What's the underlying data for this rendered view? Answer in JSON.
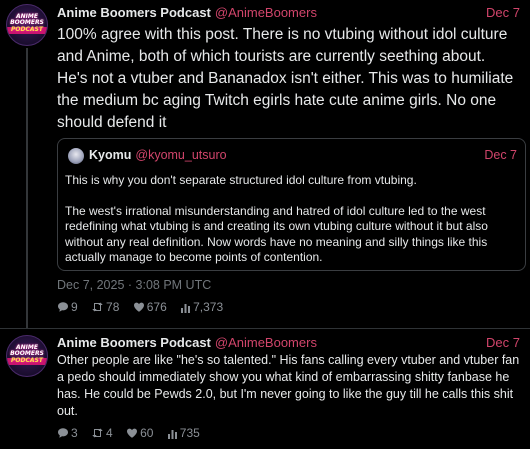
{
  "posts": [
    {
      "author": "Anime Boomers Podcast",
      "handle": "@AnimeBoomers",
      "date": "Dec 7",
      "avatar_text": [
        "ANIME",
        "BOOMERS",
        "PODCAST"
      ],
      "text": "100% agree with this post. There is no vtubing without idol culture and Anime, both of which tourists are currently seething about. He's not a vtuber and Bananadox isn't either. This was to humiliate the medium bc aging Twitch egirls hate cute anime girls. No one should defend it",
      "quote": {
        "author": "Kyomu",
        "handle": "@kyomu_utsuro",
        "date": "Dec 7",
        "paragraph1": "This is why you don't separate structured idol culture from vtubing.",
        "paragraph2": "The west's irrational misunderstanding and hatred of idol culture led to the west redefining what vtubing is and creating its own vtubing culture without it but also without any real definition. Now words have no meaning and silly things like this actually manage to become points of contention."
      },
      "timestamp": "Dec 7, 2025 · 3:08 PM UTC",
      "stats": {
        "replies": "9",
        "reposts": "78",
        "likes": "676",
        "views": "7,373"
      }
    },
    {
      "author": "Anime Boomers Podcast",
      "handle": "@AnimeBoomers",
      "date": "Dec 7",
      "avatar_text": [
        "ANIME",
        "BOOMERS",
        "PODCAST"
      ],
      "text": "Other people are like \"he's so talented.\" His fans calling every vtuber and vtuber fan a pedo should immediately show you what kind of embarrassing shitty fanbase he has. He could be Pewds 2.0, but I'm never going to like the guy till he calls this shit out.",
      "stats": {
        "replies": "3",
        "reposts": "4",
        "likes": "60",
        "views": "735"
      }
    }
  ],
  "icons": [
    "comment-icon",
    "retweet-icon",
    "heart-icon",
    "chart-icon"
  ],
  "colors": {
    "background": "#000000",
    "text": "#e7e9ea",
    "accent": "#d1456b",
    "muted": "#71767b"
  }
}
